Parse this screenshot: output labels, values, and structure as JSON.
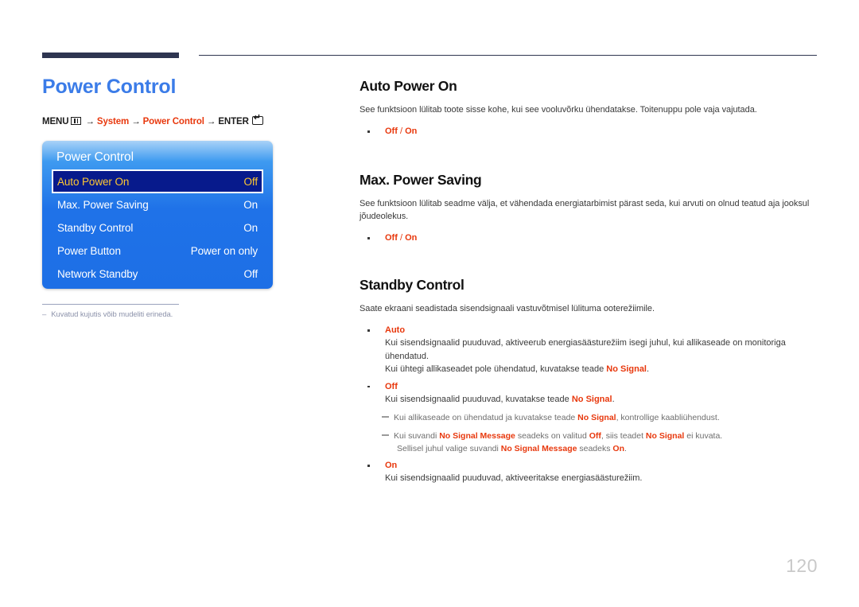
{
  "header": {
    "rule_color": "#2e3550"
  },
  "left": {
    "title": "Power Control",
    "title_color": "#3b7ce8",
    "breadcrumb": {
      "menu_label": "MENU",
      "menu_icon": "menu-grid-icon",
      "arrow": "→",
      "step1": "System",
      "step2": "Power Control",
      "enter_label": "ENTER",
      "enter_icon": "enter-key-icon",
      "accent_color": "#e8380d"
    },
    "osd": {
      "title": "Power Control",
      "rows": [
        {
          "label": "Auto Power On",
          "value": "Off",
          "selected": true
        },
        {
          "label": "Max. Power Saving",
          "value": "On",
          "selected": false
        },
        {
          "label": "Standby Control",
          "value": "On",
          "selected": false
        },
        {
          "label": "Power Button",
          "value": "Power on only",
          "selected": false
        },
        {
          "label": "Network Standby",
          "value": "Off",
          "selected": false
        }
      ],
      "selected_bg": "#071a8c",
      "selected_text_color": "#ffc832"
    },
    "caption": {
      "dash": "–",
      "text": "Kuvatud kujutis võib mudeliti erineda."
    }
  },
  "right": {
    "sections": [
      {
        "heading": "Auto Power On",
        "paragraph": "See funktsioon lülitab toote sisse kohe, kui see vooluvõrku ühendatakse. Toitenuppu pole vaja vajutada.",
        "option_off": "Off",
        "option_sep": " / ",
        "option_on": "On"
      },
      {
        "heading": "Max. Power Saving",
        "paragraph": "See funktsioon lülitab seadme välja, et vähendada energiatarbimist pärast seda, kui arvuti on olnud teatud aja jooksul jõudeolekus.",
        "option_off": "Off",
        "option_sep": " / ",
        "option_on": "On"
      },
      {
        "heading": "Standby Control",
        "paragraph": "Saate ekraani seadistada sisendsignaali vastuvõtmisel lülituma ooterežiimile."
      }
    ],
    "standby": {
      "auto": {
        "label": "Auto",
        "line1": "Kui sisendsignaalid puuduvad, aktiveerub energiasäästurežiim isegi juhul, kui allikaseade on monitoriga ühendatud.",
        "line2_a": "Kui ühtegi allikaseadet pole ühendatud, kuvatakse teade ",
        "line2_b": "No Signal",
        "line2_c": "."
      },
      "off": {
        "label": "Off",
        "line1_a": "Kui sisendsignaalid puuduvad, kuvatakse teade ",
        "line1_b": "No Signal",
        "line1_c": ".",
        "note1_a": "Kui allikaseade on ühendatud ja kuvatakse teade ",
        "note1_b": "No Signal",
        "note1_c": ", kontrollige kaabliühendust.",
        "note2_a": "Kui suvandi ",
        "note2_b": "No Signal Message",
        "note2_c": " seadeks on valitud ",
        "note2_d": "Off",
        "note2_e": ", siis teadet ",
        "note2_f": "No Signal",
        "note2_g": " ei kuvata.",
        "note2_cont_a": "Sellisel juhul valige suvandi ",
        "note2_cont_b": "No Signal Message",
        "note2_cont_c": " seadeks ",
        "note2_cont_d": "On",
        "note2_cont_e": "."
      },
      "on": {
        "label": "On",
        "line1": "Kui sisendsignaalid puuduvad, aktiveeritakse energiasäästurežiim."
      }
    }
  },
  "footer": {
    "page_number": "120"
  }
}
